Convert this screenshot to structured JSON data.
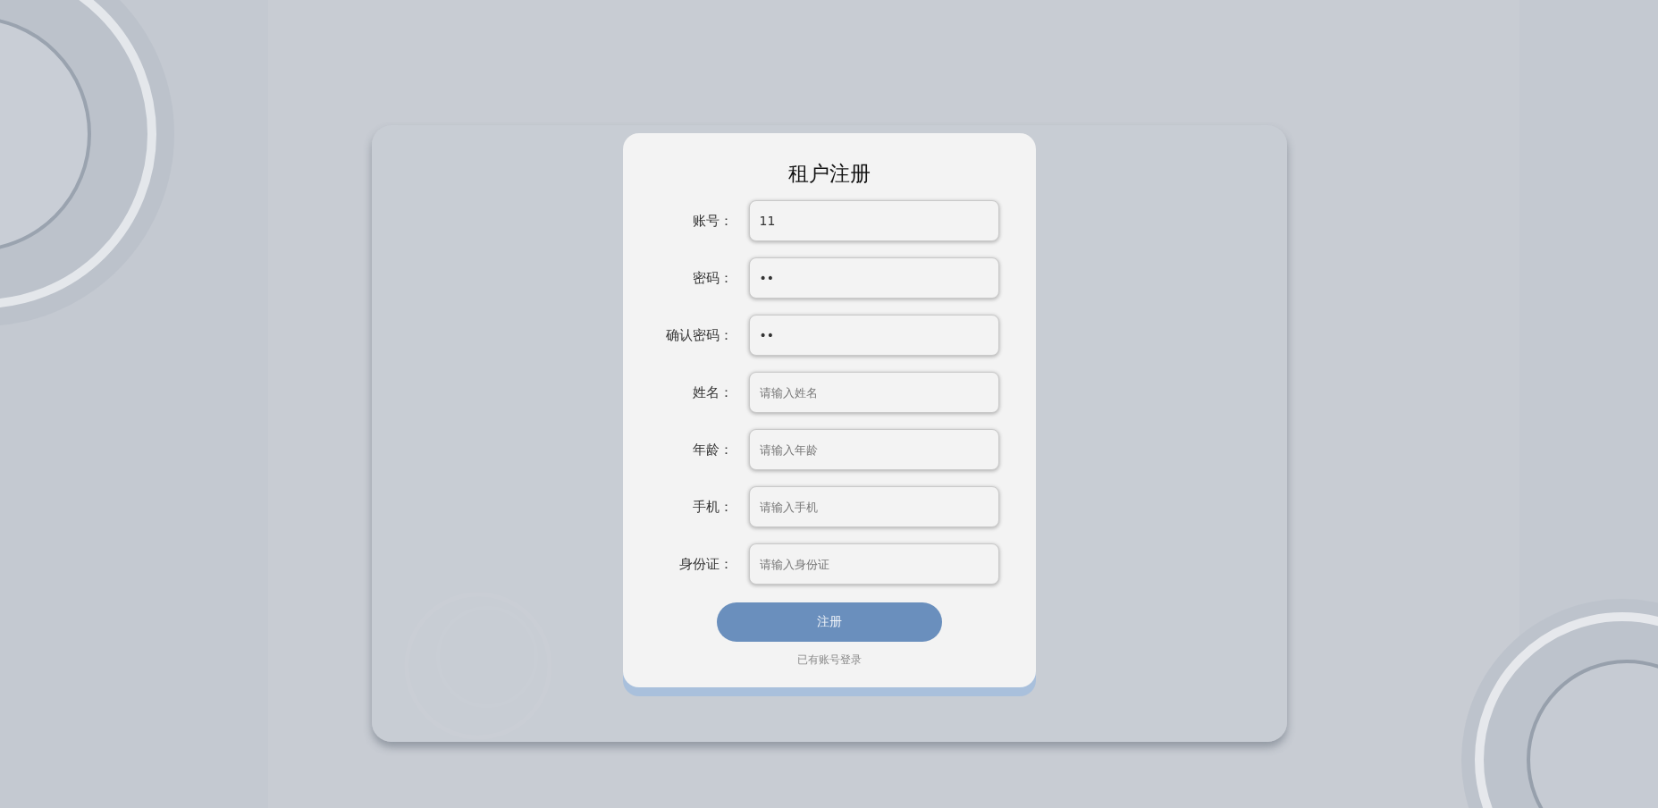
{
  "form": {
    "title": "租户注册",
    "fields": [
      {
        "label": "账号：",
        "value": "11"
      },
      {
        "label": "密码：",
        "value": "••"
      },
      {
        "label": "确认密码：",
        "value": "••"
      },
      {
        "label": "姓名：",
        "placeholder": "请输入姓名"
      },
      {
        "label": "年龄：",
        "placeholder": "请输入年龄"
      },
      {
        "label": "手机：",
        "placeholder": "请输入手机"
      },
      {
        "label": "身份证：",
        "placeholder": "请输入身份证"
      }
    ],
    "submit_button": "注册",
    "login_link": "已有账号登录"
  }
}
